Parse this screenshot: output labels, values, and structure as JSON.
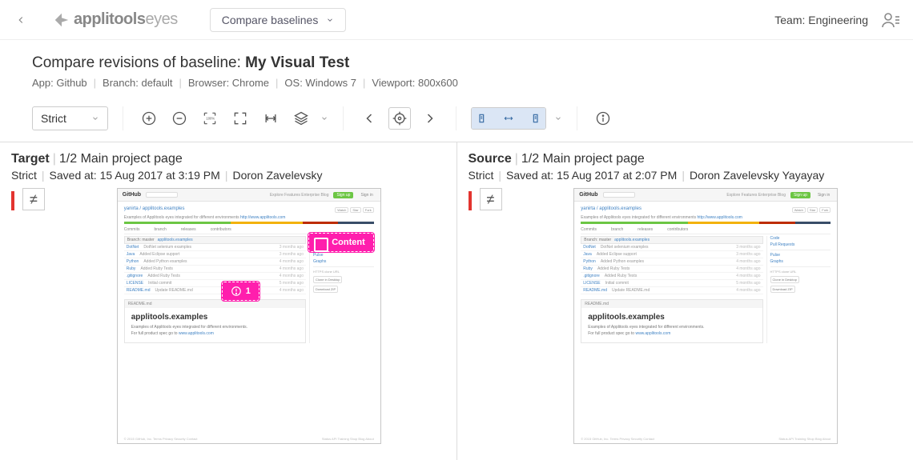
{
  "topbar": {
    "brand_bold": "applitools",
    "brand_light": "eyes",
    "dropdown_label": "Compare baselines",
    "team_label": "Team: Engineering"
  },
  "header": {
    "title_prefix": "Compare revisions of baseline: ",
    "title_name": "My Visual Test",
    "app": "App: Github",
    "branch": "Branch: default",
    "browser": "Browser: Chrome",
    "os": "OS: Windows 7",
    "viewport": "Viewport: 800x600"
  },
  "toolbar": {
    "match_level": "Strict"
  },
  "target": {
    "label": "Target",
    "step": "1/2 Main project page",
    "match": "Strict",
    "saved": "Saved at: 15 Aug 2017 at 3:19 PM",
    "author": "Doron Zavelevsky",
    "status_glyph": "≠",
    "region_label": "Content",
    "bug_count": "1"
  },
  "source": {
    "label": "Source",
    "step": "1/2 Main project page",
    "match": "Strict",
    "saved": "Saved at: 15 Aug 2017 at 2:07 PM",
    "author": "Doron Zavelevsky Yayayay",
    "status_glyph": "≠"
  },
  "thumb": {
    "site": "GitHub",
    "signup": "Sign up",
    "signin": "Sign in",
    "nav": "Explore   Features   Enterprise   Blog",
    "crumb": "yanirta / applitools.examples",
    "mini_watch": "Watch",
    "mini_star": "Star",
    "mini_fork": "Fork",
    "desc_text": "Examples of Applitools eyes integrated for different environments ",
    "desc_link": "http://www.applitools.com",
    "tab_commits": "Commits",
    "tab_branch": "branch",
    "tab_releases": "releases",
    "tab_contrib": "contributors",
    "side_code": "Code",
    "side_pull": "Pull Requests",
    "side_pulse": "Pulse",
    "side_graphs": "Graphs",
    "side_https": "HTTPS clone URL",
    "side_clone": "Clone in Desktop",
    "side_zip": "Download ZIP",
    "filehead_branch": "Branch: master",
    "filehead_path": "applitools.examples",
    "readme_head": "README.md",
    "readme_title": "applitools.examples",
    "readme_p1": "Examples of Applitools eyes integrated for different environments.",
    "readme_p2_a": "For full product spec go to ",
    "readme_p2_b": "www.applitools.com",
    "files": [
      {
        "name": "DotNet",
        "msg": "DotNet selenium examples",
        "age": "3 months ago"
      },
      {
        "name": "Java",
        "msg": "Added Eclipse support",
        "age": "3 months ago"
      },
      {
        "name": "Python",
        "msg": "Added Python examples",
        "age": "4 months ago"
      },
      {
        "name": "Ruby",
        "msg": "Added Ruby Tests",
        "age": "4 months ago"
      },
      {
        "name": ".gitignore",
        "msg": "Added Ruby Tests",
        "age": "4 months ago"
      },
      {
        "name": "LICENSE",
        "msg": "Initial commit",
        "age": "5 months ago"
      },
      {
        "name": "README.md",
        "msg": "Update README.md",
        "age": "4 months ago"
      }
    ],
    "foot_left": "© 2015 GitHub, Inc.   Terms   Privacy   Security   Contact",
    "foot_right": "Status   API   Training   Shop   Blog   About"
  }
}
